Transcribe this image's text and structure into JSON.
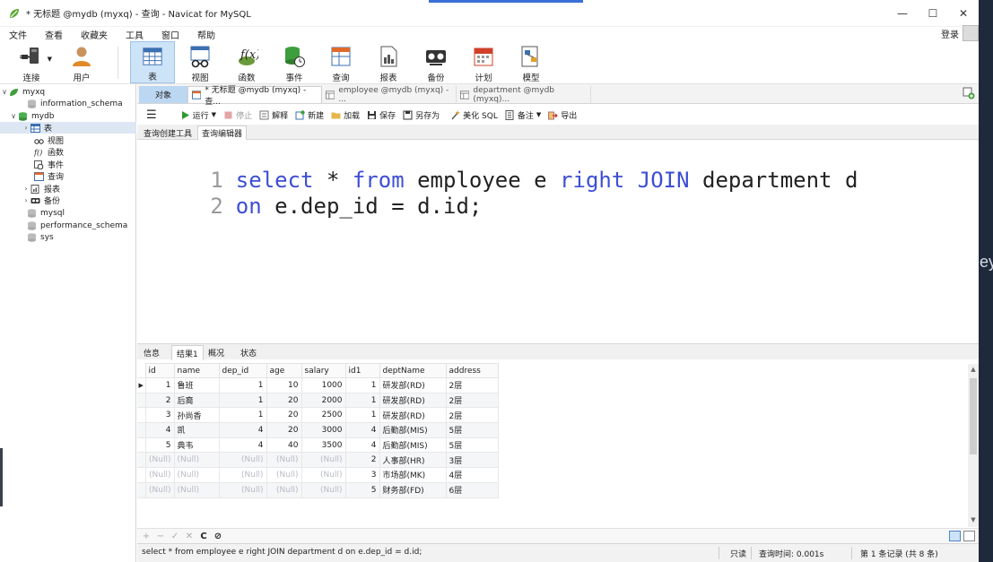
{
  "window": {
    "title": "* 无标题 @mydb (myxq) - 查询 - Navicat for MySQL",
    "controls": [
      "—",
      "☐",
      "✕"
    ]
  },
  "menu": {
    "items": [
      "文件",
      "查看",
      "收藏夹",
      "工具",
      "窗口",
      "帮助"
    ],
    "login": "登录"
  },
  "toolbar": {
    "items": [
      {
        "label": "连接",
        "icon": "connection-icon"
      },
      {
        "label": "用户",
        "icon": "user-icon"
      },
      {
        "label": "表",
        "icon": "table-icon"
      },
      {
        "label": "视图",
        "icon": "view-icon"
      },
      {
        "label": "函数",
        "icon": "function-icon"
      },
      {
        "label": "事件",
        "icon": "event-icon"
      },
      {
        "label": "查询",
        "icon": "query-icon"
      },
      {
        "label": "报表",
        "icon": "report-icon"
      },
      {
        "label": "备份",
        "icon": "backup-icon"
      },
      {
        "label": "计划",
        "icon": "schedule-icon"
      },
      {
        "label": "模型",
        "icon": "model-icon"
      }
    ],
    "active": "表"
  },
  "navigator": {
    "items": [
      {
        "label": "myxq",
        "type": "connection",
        "expanded": true
      },
      {
        "label": "information_schema",
        "type": "database"
      },
      {
        "label": "mydb",
        "type": "database",
        "expanded": true
      },
      {
        "label": "表",
        "type": "tables",
        "selected": true
      },
      {
        "label": "视图",
        "type": "views"
      },
      {
        "label": "函数",
        "type": "functions"
      },
      {
        "label": "事件",
        "type": "events"
      },
      {
        "label": "查询",
        "type": "queries"
      },
      {
        "label": "报表",
        "type": "reports"
      },
      {
        "label": "备份",
        "type": "backups"
      },
      {
        "label": "mysql",
        "type": "database"
      },
      {
        "label": "performance_schema",
        "type": "database"
      },
      {
        "label": "sys",
        "type": "database"
      }
    ]
  },
  "tabs": {
    "objects": "对象",
    "items": [
      "* 无标题 @mydb (myxq) - 查...",
      "employee @mydb (myxq) - ...",
      "department @mydb (myxq)..."
    ]
  },
  "query_toolbar": {
    "run": "运行",
    "stop": "停止",
    "explain": "解释",
    "new": "新建",
    "load": "加载",
    "save": "保存",
    "save_as": "另存为",
    "beautify": "美化 SQL",
    "comment": "备注",
    "export": "导出"
  },
  "sub_tabs": [
    "查询创建工具",
    "查询编辑器"
  ],
  "editor": {
    "lines": [
      {
        "num": "1",
        "tokens": [
          {
            "t": "select",
            "kw": true
          },
          {
            "t": " * ",
            "kw": false
          },
          {
            "t": "from",
            "kw": true
          },
          {
            "t": " employee e ",
            "kw": false
          },
          {
            "t": "right",
            "kw": true
          },
          {
            "t": " ",
            "kw": false
          },
          {
            "t": "JOIN",
            "kw": true
          },
          {
            "t": " department d",
            "kw": false
          }
        ]
      },
      {
        "num": "2",
        "tokens": [
          {
            "t": "on",
            "kw": true
          },
          {
            "t": " e.dep_id = d.id;",
            "kw": false
          }
        ]
      }
    ]
  },
  "result_tabs": [
    "信息",
    "结果1",
    "概况",
    "状态"
  ],
  "grid": {
    "columns": [
      "id",
      "name",
      "dep_id",
      "age",
      "salary",
      "id1",
      "deptName",
      "address"
    ],
    "rows": [
      [
        "1",
        "鲁班",
        "1",
        "10",
        "1000",
        "1",
        "研发部(RD)",
        "2层"
      ],
      [
        "2",
        "后裔",
        "1",
        "20",
        "2000",
        "1",
        "研发部(RD)",
        "2层"
      ],
      [
        "3",
        "孙尚香",
        "1",
        "20",
        "2500",
        "1",
        "研发部(RD)",
        "2层"
      ],
      [
        "4",
        "凯",
        "4",
        "20",
        "3000",
        "4",
        "后勤部(MIS)",
        "5层"
      ],
      [
        "5",
        "典韦",
        "4",
        "40",
        "3500",
        "4",
        "后勤部(MIS)",
        "5层"
      ],
      [
        "(Null)",
        "(Null)",
        "(Null)",
        "(Null)",
        "(Null)",
        "2",
        "人事部(HR)",
        "3层"
      ],
      [
        "(Null)",
        "(Null)",
        "(Null)",
        "(Null)",
        "(Null)",
        "3",
        "市场部(MK)",
        "4层"
      ],
      [
        "(Null)",
        "(Null)",
        "(Null)",
        "(Null)",
        "(Null)",
        "5",
        "财务部(FD)",
        "6层"
      ]
    ]
  },
  "grid_toolbar": [
    "+",
    "−",
    "✓",
    "✕",
    "C",
    "⊘"
  ],
  "status": {
    "sql": "select * from employee e right JOIN department d  on e.dep_id = d.id;",
    "mode": "只读",
    "time": "查询时间: 0.001s",
    "records": "第 1 条记录 (共 8 条)"
  },
  "desktop_text": "ey",
  "colors": {
    "keyword": "#3d4ed3",
    "objects_tab": "#bcd7f2",
    "selected": "#dde7f3",
    "null_text": "#b8bac4"
  }
}
